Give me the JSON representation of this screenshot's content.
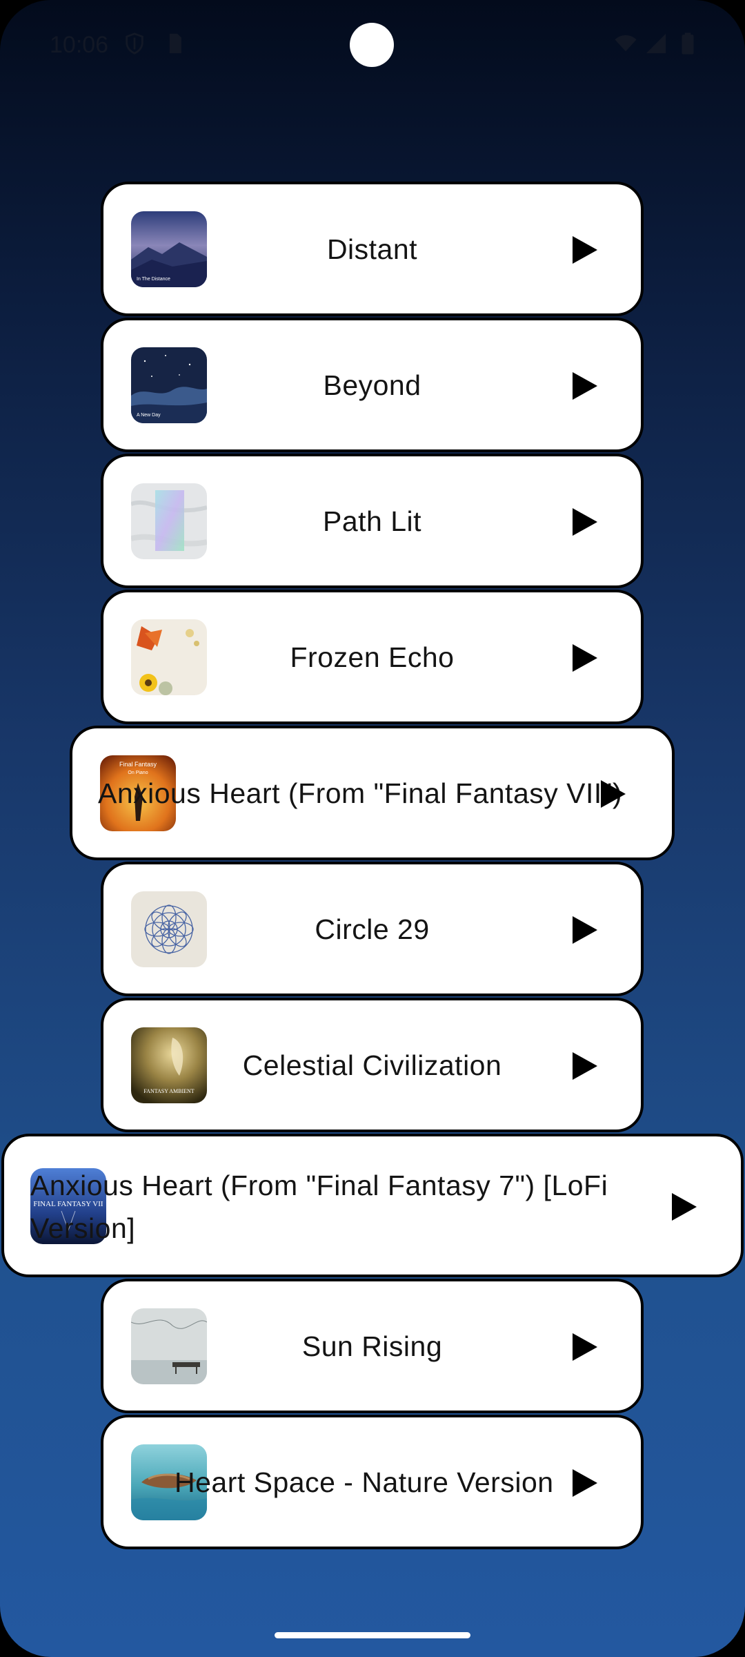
{
  "status_bar": {
    "time": "10:06"
  },
  "songs": [
    {
      "title": "Distant"
    },
    {
      "title": "Beyond"
    },
    {
      "title": "Path Lit"
    },
    {
      "title": "Frozen Echo"
    },
    {
      "title": "Anxious Heart (From \"Final Fantasy VII\")"
    },
    {
      "title": "Circle 29"
    },
    {
      "title": "Celestial Civilization"
    },
    {
      "title": "Anxious Heart (From \"Final Fantasy 7\") [LoFi Version]"
    },
    {
      "title": "Sun Rising"
    },
    {
      "title": "Heart Space - Nature Version"
    }
  ],
  "cover_texts": {
    "distant": "In The Distance",
    "beyond": "A New Day",
    "anxious1_line1": "Final Fantasy",
    "anxious1_line2": "On Piano",
    "celestial": "FANTASY AMBIENT",
    "anxious2": "FINAL FANTASY VII"
  },
  "colors": {
    "card_bg": "#ffffff",
    "card_border": "#000000",
    "bg_top": "#030b1c",
    "bg_bottom": "#2358a0"
  }
}
